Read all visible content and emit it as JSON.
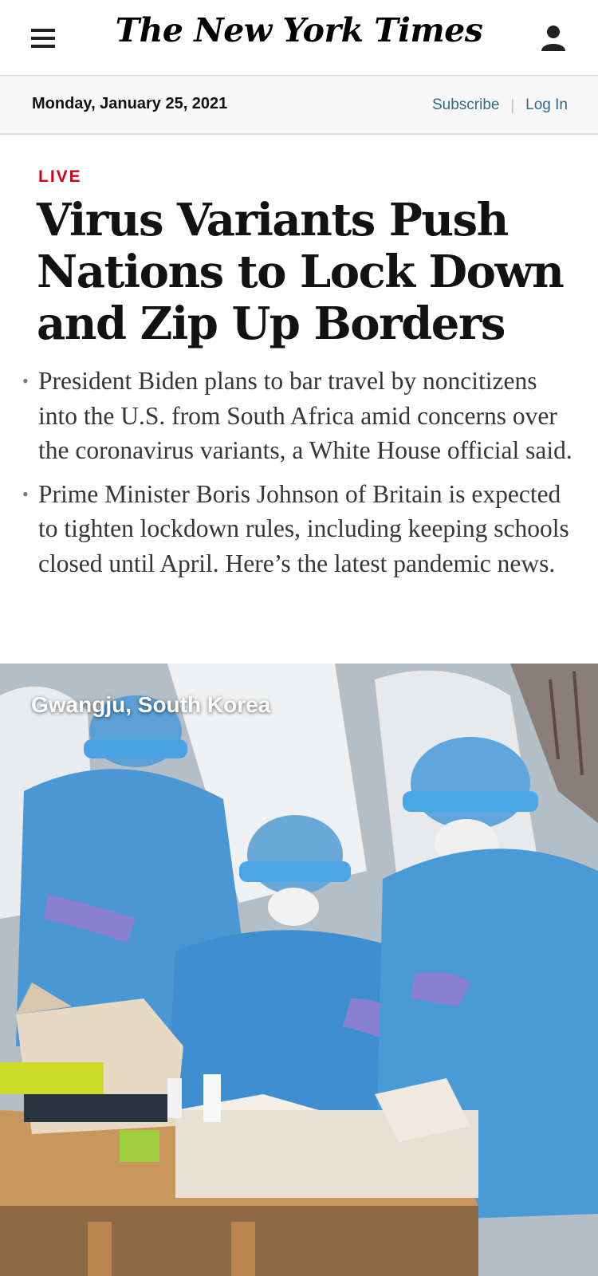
{
  "header": {
    "logo": "The New York Times",
    "menu_icon": "hamburger-menu-icon",
    "account_icon": "user-account-icon"
  },
  "datebar": {
    "date": "Monday, January 25, 2021",
    "subscribe": "Subscribe",
    "login": "Log In"
  },
  "article": {
    "badge": "LIVE",
    "headline": "Virus Variants Push Nations to Lock Down and Zip Up Borders",
    "summary": [
      "President Biden plans to bar travel by noncitizens into the U.S. from South Africa amid concerns over the coronavirus variants, a White House official said.",
      "Prime Minister Boris Johnson of Britain is expected to tighten lockdown rules, including keeping schools closed until April. Here’s the latest pandemic news."
    ],
    "photo_caption": "Gwangju, South Korea"
  },
  "colors": {
    "live_red": "#d0021b",
    "link_blue": "#326891"
  }
}
